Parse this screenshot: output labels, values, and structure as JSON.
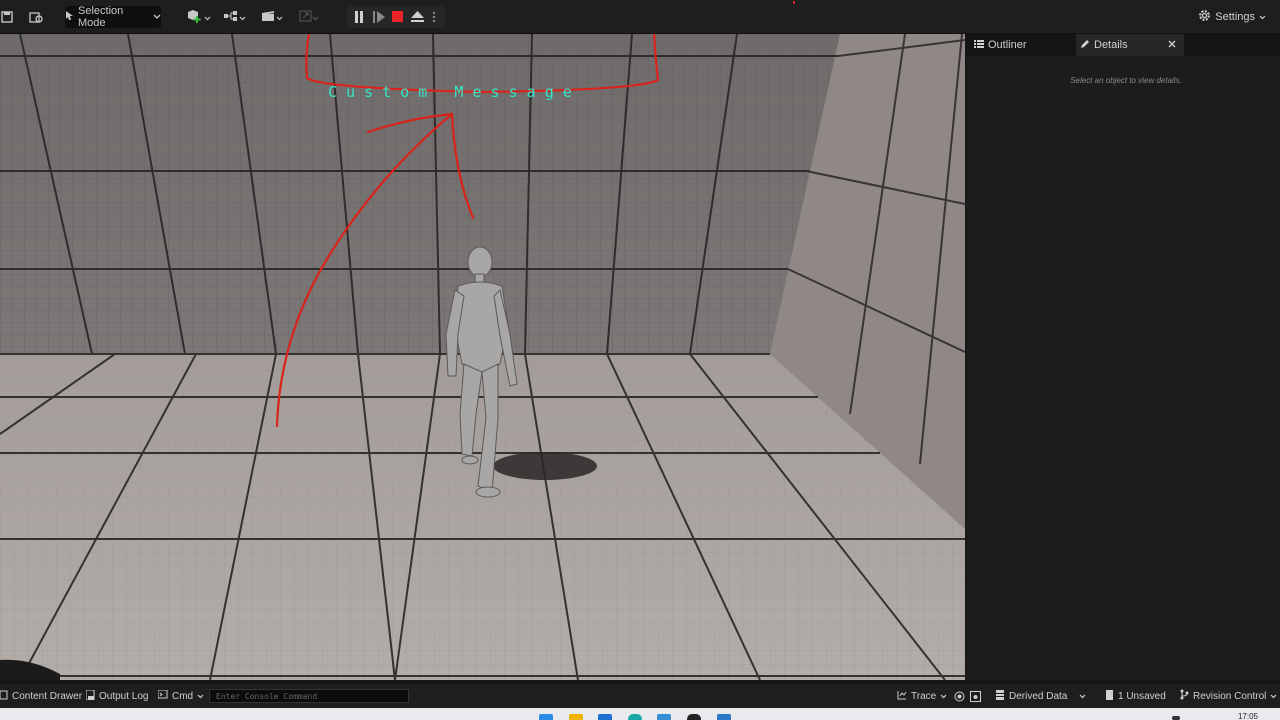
{
  "toolbar": {
    "mode_label": "Selection Mode",
    "settings_label": "Settings"
  },
  "viewport": {
    "custom_message": "C u s t o m   M e s s a g e",
    "annotation_color": "#d9231b",
    "message_color": "#33e6c9"
  },
  "panel": {
    "tabs": [
      {
        "label": "Outliner"
      },
      {
        "label": "Details"
      }
    ],
    "empty_hint": "Select an object to view details."
  },
  "statusbar": {
    "content_drawer": "Content Drawer",
    "output_log": "Output Log",
    "cmd": "Cmd",
    "console_placeholder": "Enter Console Command",
    "trace": "Trace",
    "derived_data": "Derived Data",
    "unsaved": "1 Unsaved",
    "revision_control": "Revision Control"
  },
  "taskbar": {
    "clock": "17:05"
  }
}
